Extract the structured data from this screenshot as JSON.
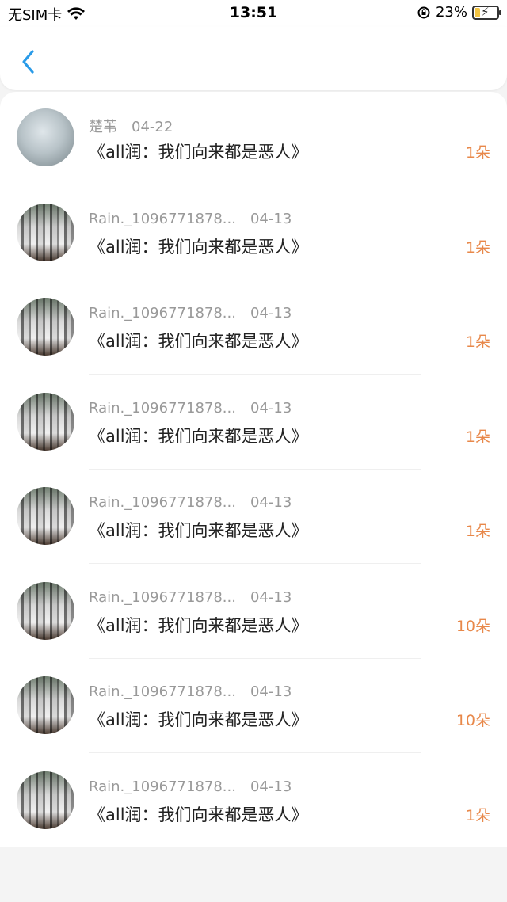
{
  "status_bar": {
    "carrier": "无SIM卡",
    "time": "13:51",
    "battery_percent": "23%",
    "icons": [
      "wifi-icon",
      "orientation-lock-icon",
      "battery-charging-icon"
    ]
  },
  "nav": {
    "back_icon": "chevron-left-icon",
    "accent": "#2a9be8"
  },
  "colors": {
    "count": "#e8884a",
    "meta": "#999999",
    "title": "#222222"
  },
  "items": [
    {
      "user": "楚苇",
      "date": "04-22",
      "title": "《all润：我们向来都是恶人》",
      "count": "1朵"
    },
    {
      "user": "Rain._1096771878...",
      "date": "04-13",
      "title": "《all润：我们向来都是恶人》",
      "count": "1朵"
    },
    {
      "user": "Rain._1096771878...",
      "date": "04-13",
      "title": "《all润：我们向来都是恶人》",
      "count": "1朵"
    },
    {
      "user": "Rain._1096771878...",
      "date": "04-13",
      "title": "《all润：我们向来都是恶人》",
      "count": "1朵"
    },
    {
      "user": "Rain._1096771878...",
      "date": "04-13",
      "title": "《all润：我们向来都是恶人》",
      "count": "1朵"
    },
    {
      "user": "Rain._1096771878...",
      "date": "04-13",
      "title": "《all润：我们向来都是恶人》",
      "count": "10朵"
    },
    {
      "user": "Rain._1096771878...",
      "date": "04-13",
      "title": "《all润：我们向来都是恶人》",
      "count": "10朵"
    },
    {
      "user": "Rain._1096771878...",
      "date": "04-13",
      "title": "《all润：我们向来都是恶人》",
      "count": "1朵"
    }
  ]
}
